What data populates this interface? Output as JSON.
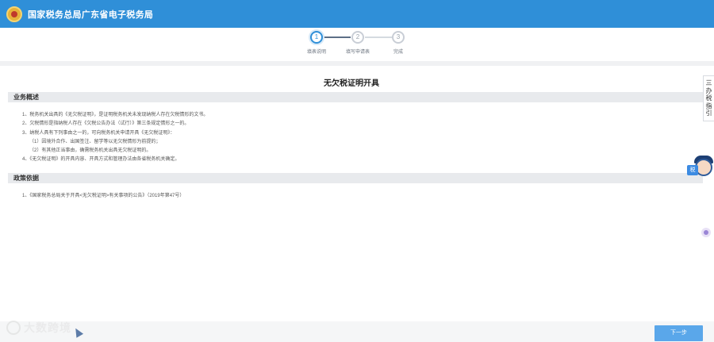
{
  "header": {
    "site_title": "国家税务总局广东省电子税务局",
    "emblem_icon": "tax-emblem-icon"
  },
  "steps": [
    {
      "number": "1",
      "label": "填表说明",
      "state": "active"
    },
    {
      "number": "2",
      "label": "填写申请表",
      "state": "pending"
    },
    {
      "number": "3",
      "label": "完成",
      "state": "pending"
    }
  ],
  "main": {
    "title": "无欠税证明开具",
    "sections": [
      {
        "heading": "业务概述",
        "items": [
          "1、税务机关出具的《无欠税证明》，是证明税务机关未发现纳税人存在欠税情形的文书。",
          "2、欠税情形是指纳税人存在《欠税公告办法（试行）》第三条规定情形之一的。",
          "3、纳税人具有下列事由之一的，可向税务机关申请开具《无欠税证明》：",
          "（1）因境外合作、出国签注、留学等以无欠税情形为前提的；",
          "（2）有其他正当事由，确需税务机关出具无欠税证明的。",
          "4、《无欠税证明》的开具内容、开具方式和管理办法由各省税务机关确定。"
        ]
      },
      {
        "heading": "政策依据",
        "items": [
          "1、《国家税务总局关于开具<无欠税证明>有关事项的公告》（2019年第47号）"
        ]
      }
    ]
  },
  "side": {
    "guide_label": [
      "三",
      "办",
      "税",
      "指",
      "引"
    ],
    "assistant_tag": "税"
  },
  "footer": {
    "next_label": "下一步",
    "watermark": "大数跨境"
  },
  "colors": {
    "header_bg": "#2f8fd8",
    "button_bg": "#5aa7ea",
    "section_bg": "#e8eaed"
  }
}
